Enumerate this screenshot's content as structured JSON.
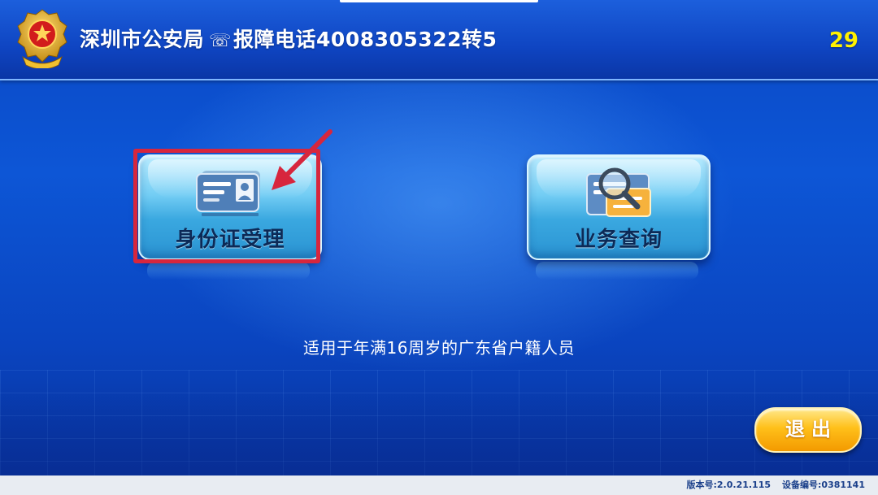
{
  "header": {
    "title": "深圳市公安局",
    "phone_icon": "☏",
    "hotline": "报障电话4008305322转5",
    "countdown": "29",
    "emblem_icon": "police-emblem-icon"
  },
  "tiles": [
    {
      "label": "身份证受理",
      "icon": "id-card-icon"
    },
    {
      "label": "业务查询",
      "icon": "magnifier-document-icon"
    }
  ],
  "subtitle": "适用于年满16周岁的广东省户籍人员",
  "exit_label": "退出",
  "footer": {
    "version": "版本号:2.0.21.115",
    "device": "设备编号:0381141"
  },
  "colors": {
    "background": "#0d56d6",
    "countdown": "#fff200",
    "highlight": "#d7263d",
    "exit_button": "#ffc01a"
  }
}
